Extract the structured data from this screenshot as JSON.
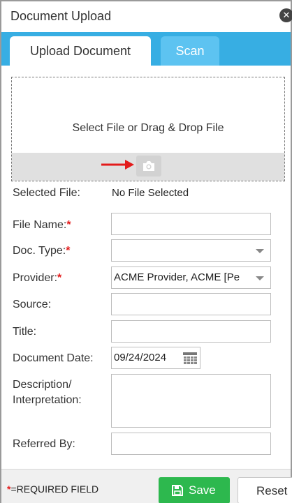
{
  "dialog": {
    "title": "Document Upload",
    "close_glyph": "✕"
  },
  "tabs": [
    {
      "label": "Upload Document",
      "active": true
    },
    {
      "label": "Scan",
      "active": false
    }
  ],
  "dropzone": {
    "text": "Select File or Drag & Drop File",
    "camera_icon": "camera-icon",
    "arrow_color": "#e31b1b"
  },
  "form": {
    "selected_file": {
      "label": "Selected File:",
      "value": "No File Selected"
    },
    "file_name": {
      "label": "File Name:",
      "required_mark": "*",
      "value": ""
    },
    "doc_type": {
      "label": "Doc. Type:",
      "required_mark": "*",
      "value": ""
    },
    "provider": {
      "label": "Provider:",
      "required_mark": "*",
      "value": "ACME Provider, ACME [Pe"
    },
    "source": {
      "label": "Source:",
      "value": ""
    },
    "title": {
      "label": "Title:",
      "value": ""
    },
    "document_date": {
      "label": "Document Date:",
      "value": "09/24/2024"
    },
    "description": {
      "label_line1": "Description/",
      "label_line2": "Interpretation:",
      "value": ""
    },
    "referred_by": {
      "label": "Referred By:",
      "value": ""
    }
  },
  "footer": {
    "required_mark": "*",
    "required_note": "=REQUIRED FIELD",
    "save_label": "Save",
    "reset_label": "Reset"
  },
  "colors": {
    "tab_strip": "#37aee3",
    "tab_inactive": "#5dc3f1",
    "required": "#e31b1b",
    "save_button": "#2db84e"
  }
}
